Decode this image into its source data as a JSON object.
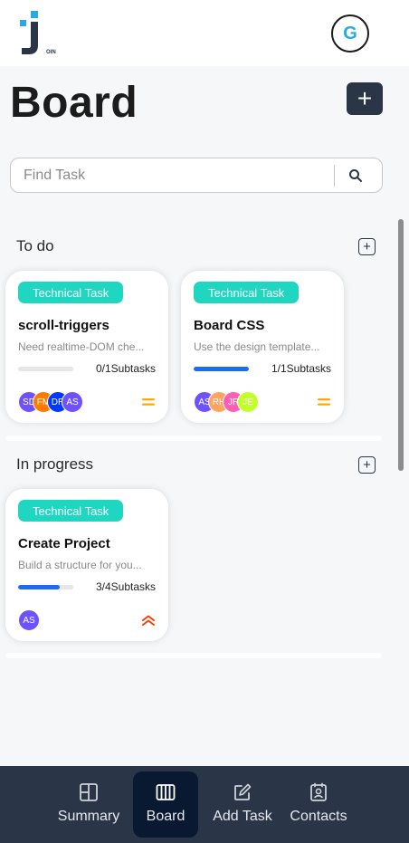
{
  "header": {
    "logo_text": "OIN",
    "user_initial": "G"
  },
  "page": {
    "title": "Board",
    "add_label": "+"
  },
  "search": {
    "placeholder": "Find Task"
  },
  "columns": [
    {
      "title": "To do",
      "add_label": "+",
      "cards": [
        {
          "tag": "Technical Task",
          "title": "scroll-triggers",
          "description": "Need realtime-DOM che...",
          "progress": 0,
          "subtasks": "0/1Subtasks",
          "assignees": [
            {
              "initials": "SD",
              "color": "#6e52ff"
            },
            {
              "initials": "FM",
              "color": "#ff7a00"
            },
            {
              "initials": "DR",
              "color": "#0038ff"
            },
            {
              "initials": "AS",
              "color": "#6e52ff"
            }
          ],
          "priority": "medium"
        },
        {
          "tag": "Technical Task",
          "title": "Board CSS",
          "description": "Use the design template...",
          "progress": 1,
          "subtasks": "1/1Subtasks",
          "assignees": [
            {
              "initials": "AS",
              "color": "#6e52ff"
            },
            {
              "initials": "RH",
              "color": "#ffa35e"
            },
            {
              "initials": "JR",
              "color": "#ff5eb3"
            },
            {
              "initials": "JE",
              "color": "#c3ff2b"
            }
          ],
          "priority": "medium"
        }
      ]
    },
    {
      "title": "In progress",
      "add_label": "+",
      "cards": [
        {
          "tag": "Technical Task",
          "title": "Create Project",
          "description": "Build a structure for you...",
          "progress": 0.75,
          "subtasks": "3/4Subtasks",
          "assignees": [
            {
              "initials": "AS",
              "color": "#6e52ff"
            }
          ],
          "priority": "urgent"
        }
      ]
    }
  ],
  "nav": {
    "summary": "Summary",
    "board": "Board",
    "add_task": "Add Task",
    "contacts": "Contacts"
  },
  "colors": {
    "nav_bg": "#2a3647",
    "nav_active": "#091931",
    "tag_bg": "#1fd7c1",
    "progress_fill": "#1a6df2",
    "priority_medium": "#ffa800",
    "priority_urgent": "#ff3d00",
    "brand_blue": "#29abe2"
  }
}
